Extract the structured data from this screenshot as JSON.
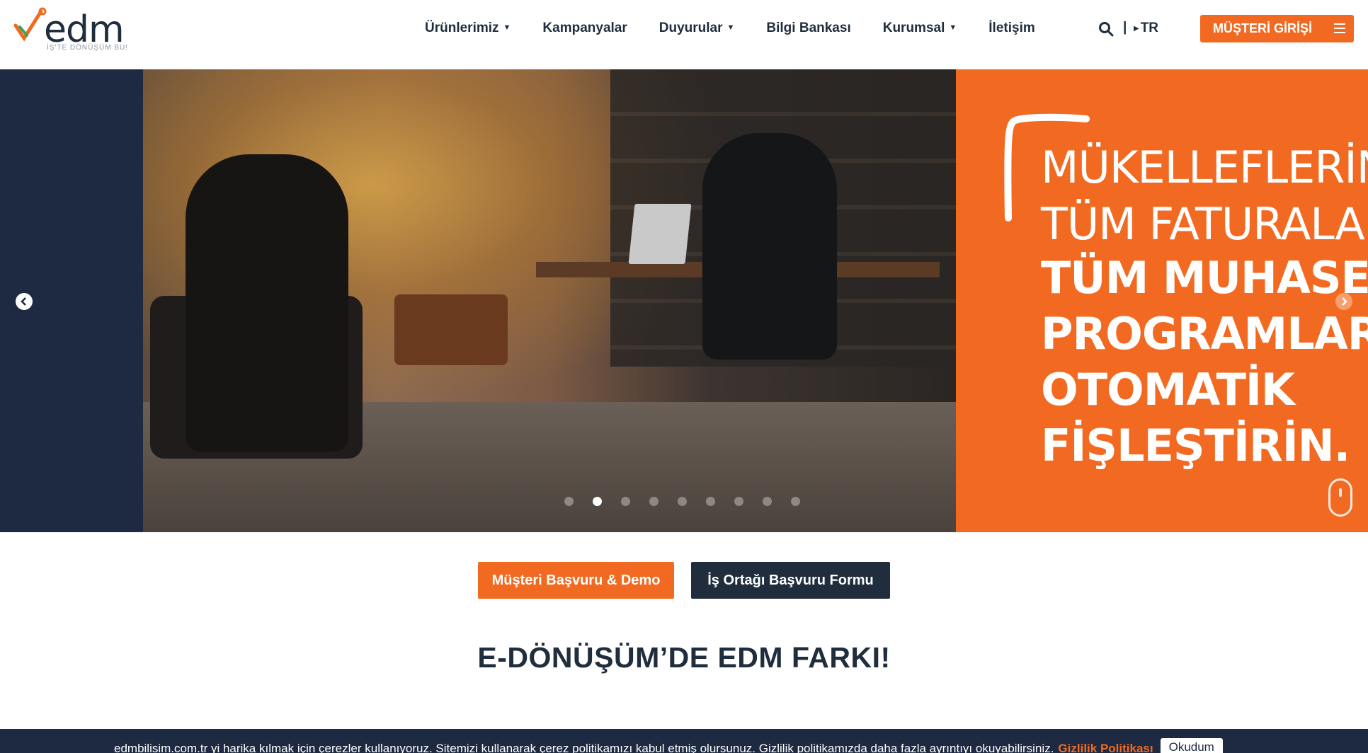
{
  "header": {
    "logo_text": "edm",
    "logo_tagline": "İŞ'TE DÖNÜŞÜM BU!",
    "nav": [
      {
        "label": "Ürünlerimiz",
        "dropdown": true
      },
      {
        "label": "Kampanyalar",
        "dropdown": false
      },
      {
        "label": "Duyurular",
        "dropdown": true
      },
      {
        "label": "Bilgi Bankası",
        "dropdown": false
      },
      {
        "label": "Kurumsal",
        "dropdown": true
      },
      {
        "label": "İletişim",
        "dropdown": false
      }
    ],
    "separator": "|",
    "language": "TR",
    "login_label": "MÜŞTERİ GİRİŞİ"
  },
  "hero": {
    "lines": [
      "MÜKELLEFLERİNİ",
      "TÜM FATURALAR",
      "TÜM MUHASE",
      "PROGRAMLAR",
      "OTOMATİK",
      "FİŞLEŞTİRİN."
    ],
    "slide_count": 9,
    "active_slide": 2
  },
  "cta": {
    "customer_label": "Müşteri Başvuru & Demo",
    "partner_label": "İş Ortağı Başvuru Formu"
  },
  "section": {
    "title": "E-DÖNÜŞÜM’DE EDM FARKI!"
  },
  "cookie": {
    "text": "edmbilisim.com.tr yi harika kılmak için çerezler kullanıyoruz. Sitemizi kullanarak çerez politikamızı kabul etmiş olursunuz. Gizlilik politikamızda daha fazla ayrıntıyı okuyabilirsiniz.",
    "link": "Gizlilik Politikası",
    "button": "Okudum"
  },
  "colors": {
    "brand_orange": "#f26a21",
    "navy": "#1f2d3d",
    "dark_navy": "#1d2a42"
  },
  "icons": {
    "search": "search-icon",
    "menu": "hamburger-icon",
    "prev": "chevron-left-circle-icon",
    "next": "chevron-right-circle-icon",
    "scroll": "mouse-scroll-icon"
  }
}
